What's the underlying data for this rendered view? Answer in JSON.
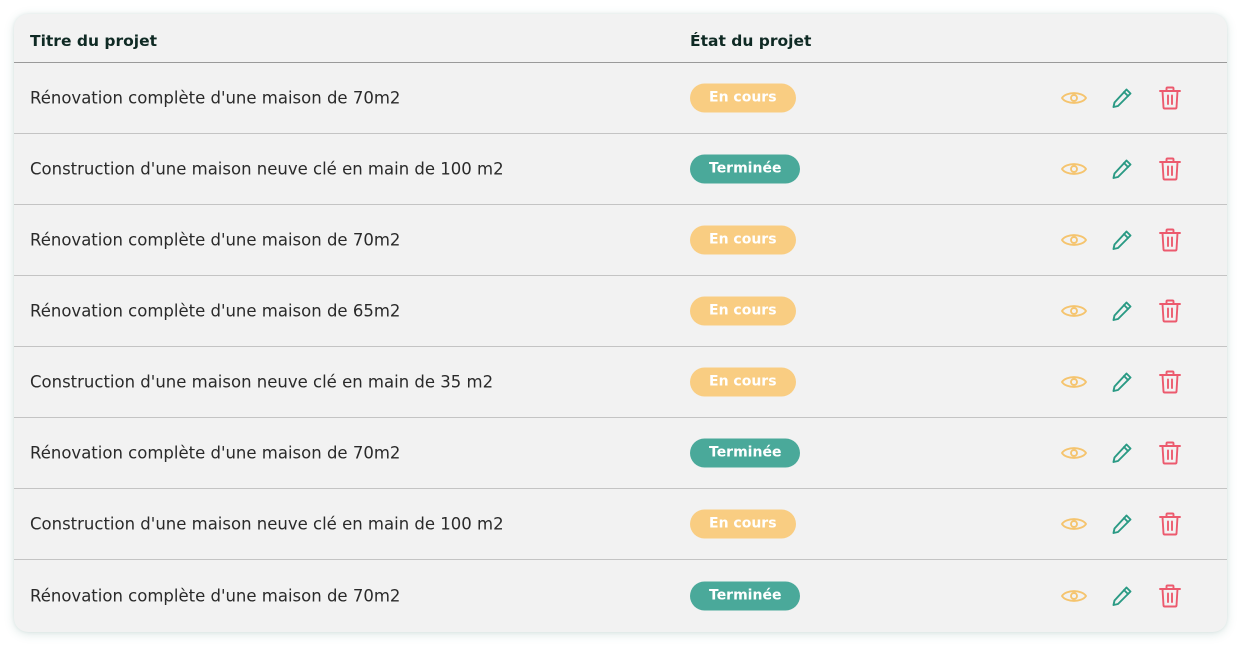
{
  "table": {
    "headers": {
      "title": "Titre du projet",
      "state": "État du projet"
    },
    "rows": [
      {
        "title": "Rénovation complète d'une maison de 70m2",
        "status": "En cours",
        "status_key": "en-cours"
      },
      {
        "title": "Construction d'une maison neuve clé en main de 100 m2",
        "status": "Terminée",
        "status_key": "terminee"
      },
      {
        "title": "Rénovation complète d'une maison de 70m2",
        "status": "En cours",
        "status_key": "en-cours"
      },
      {
        "title": "Rénovation complète d'une maison de 65m2",
        "status": "En cours",
        "status_key": "en-cours"
      },
      {
        "title": "Construction d'une maison neuve clé en main de 35 m2",
        "status": "En cours",
        "status_key": "en-cours"
      },
      {
        "title": "Rénovation complète d'une maison de 70m2",
        "status": "Terminée",
        "status_key": "terminee"
      },
      {
        "title": "Construction d'une maison neuve clé en main de 100 m2",
        "status": "En cours",
        "status_key": "en-cours"
      },
      {
        "title": "Rénovation complète d'une maison de 70m2",
        "status": "Terminée",
        "status_key": "terminee"
      }
    ]
  },
  "icons": {
    "view": "eye-icon",
    "edit": "pencil-icon",
    "delete": "trash-icon"
  },
  "colors": {
    "en_cours": "#f9cd82",
    "terminee": "#4aa99a",
    "view_icon": "#f5c46e",
    "edit_icon": "#2a9a84",
    "delete_icon": "#ec5a6e"
  }
}
